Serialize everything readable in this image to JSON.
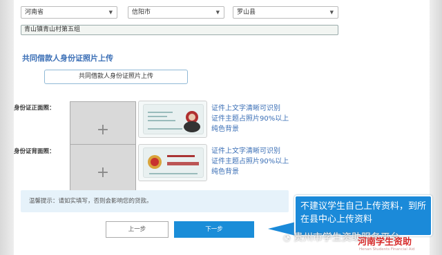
{
  "address": {
    "province": "河南省",
    "city": "信阳市",
    "county": "罗山县",
    "detail": "青山镇青山村第五组"
  },
  "section_title": "共同借款人身份证照片上传",
  "upload_button": "共同借款人身份证照片上传",
  "id_front": {
    "label": "身份证正面照：",
    "plus": "+",
    "hint_lines": [
      "证件上文字清晰可识别",
      "证件主题占照片90%以上",
      "纯色背景"
    ]
  },
  "id_back": {
    "label": "身份证背面照：",
    "plus": "+",
    "hint_lines": [
      "证件上文字清晰可识别",
      "证件主题占照片90%以上",
      "纯色背景"
    ]
  },
  "tip": "温馨提示：请如实填写，否则会影响您的贷款。",
  "buttons": {
    "prev": "上一步",
    "next": "下一步"
  },
  "callout": "不建议学生自己上传资料，到所在县中心上传资料",
  "watermark": "贵州市学生资助服务平台",
  "logo": {
    "title": "河南学生资助",
    "subtitle": "Henan Students Financial Aid"
  },
  "icons": {
    "dropdown": "chevron-down-icon",
    "add": "plus-icon",
    "wechat": "wechat-icon"
  }
}
